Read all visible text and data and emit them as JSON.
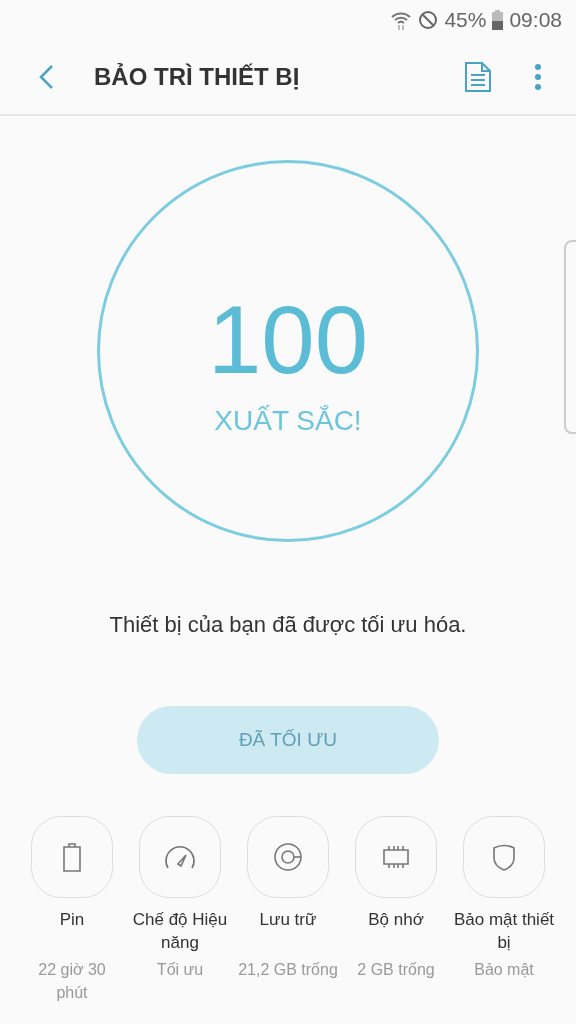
{
  "status_bar": {
    "battery": "45%",
    "time": "09:08"
  },
  "header": {
    "title": "BẢO TRÌ THIẾT BỊ"
  },
  "score": {
    "value": "100",
    "label": "XUẤT SẮC!"
  },
  "message": "Thiết bị của bạn đã được tối ưu hóa.",
  "optimize_button": {
    "label": "ĐÃ TỐI ƯU",
    "disabled": true
  },
  "categories": [
    {
      "kind": "battery",
      "name": "Pin",
      "detail": "22 giờ 30 phút"
    },
    {
      "kind": "performance",
      "name": "Chế độ Hiệu năng",
      "detail": "Tối ưu"
    },
    {
      "kind": "storage",
      "name": "Lưu trữ",
      "detail": "21,2 GB trống"
    },
    {
      "kind": "memory",
      "name": "Bộ nhớ",
      "detail": "2 GB trống"
    },
    {
      "kind": "security",
      "name": "Bảo mật thiết bị",
      "detail": "Bảo mật"
    }
  ]
}
